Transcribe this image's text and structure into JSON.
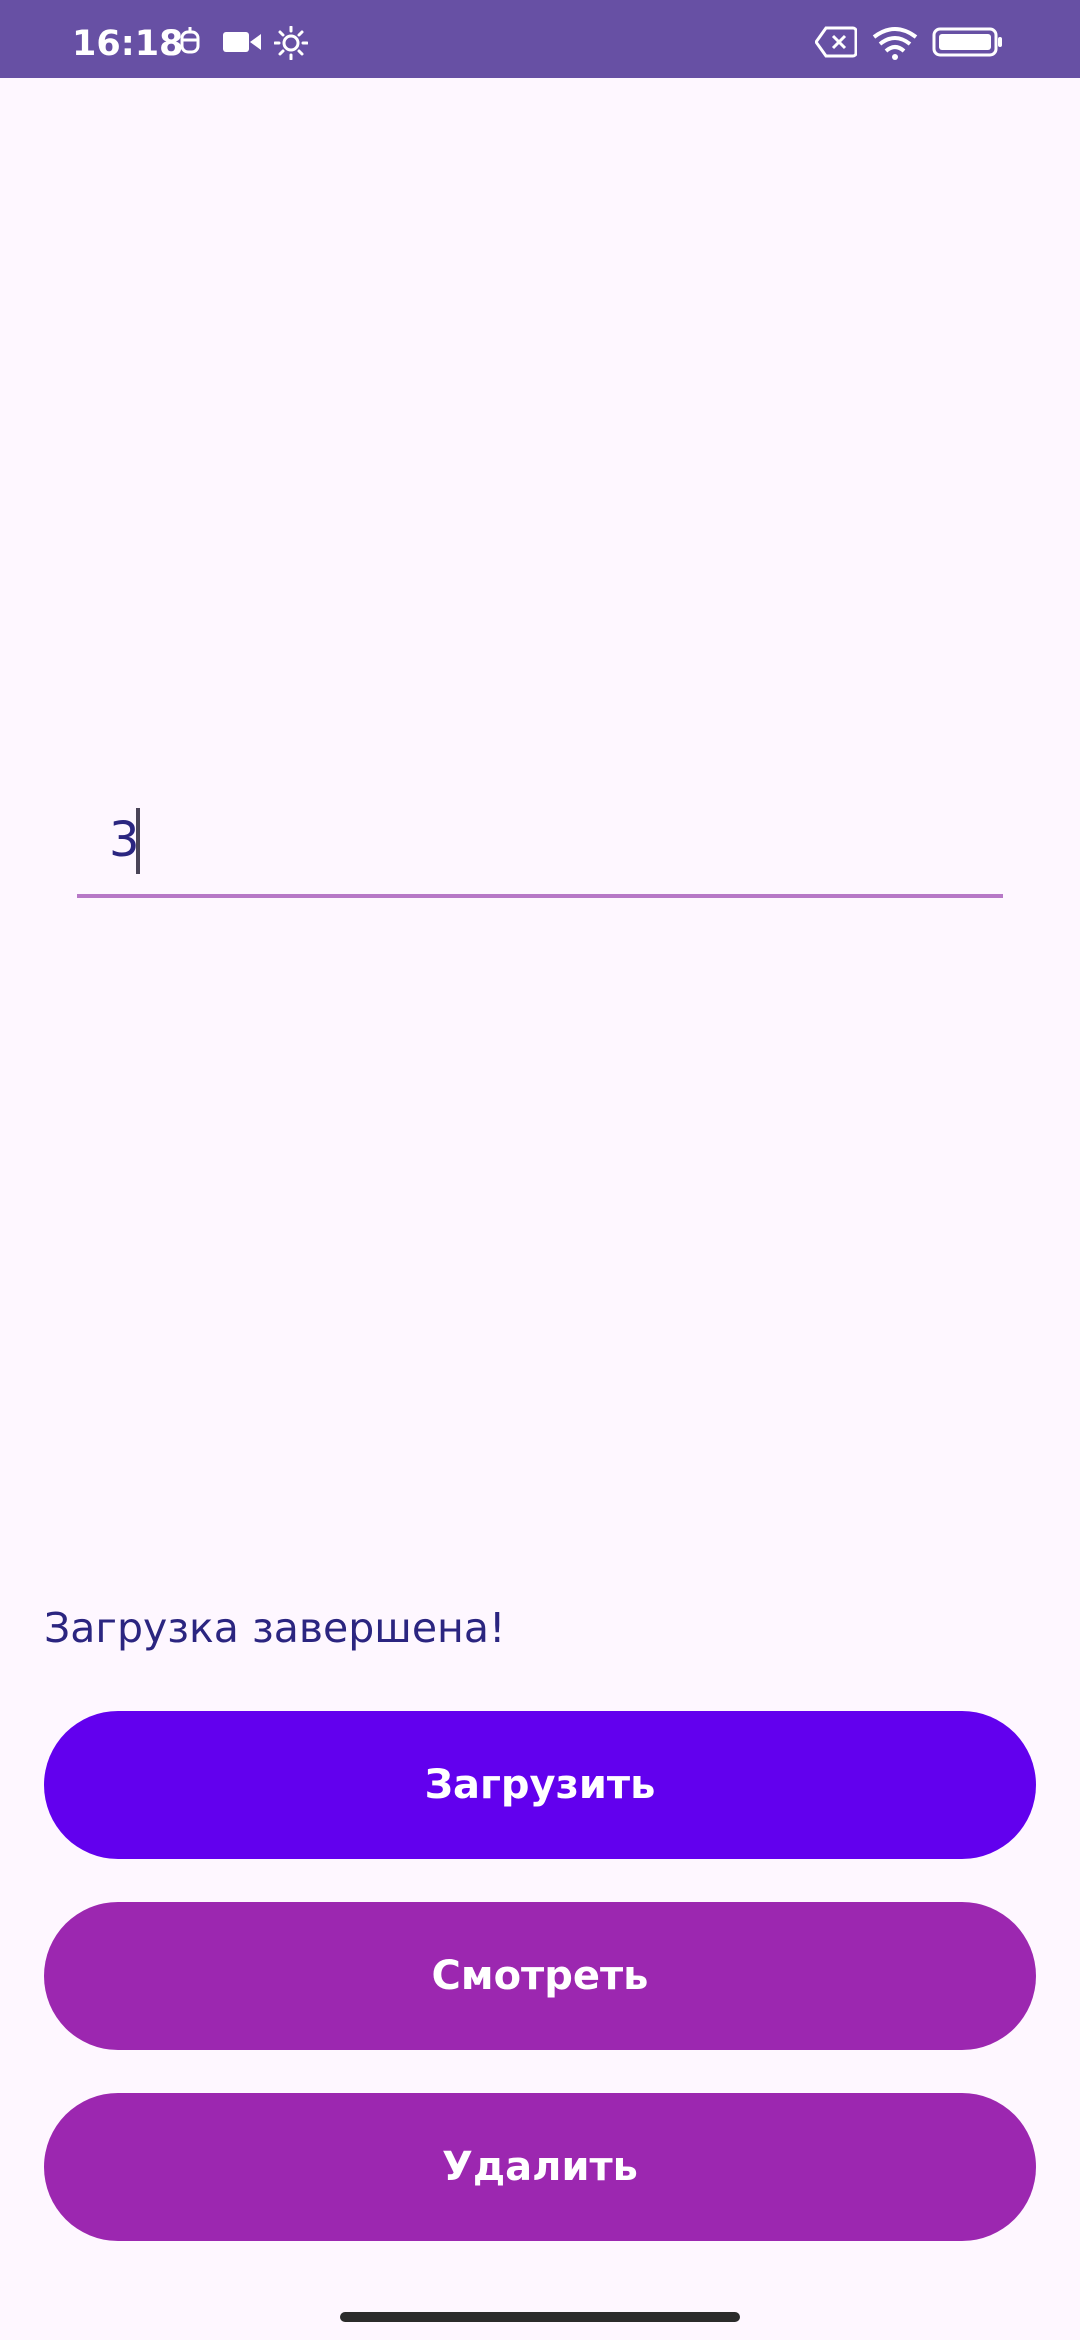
{
  "status_bar": {
    "time": "16:18",
    "background": "#6750A4",
    "icons_left": [
      "notification-icon",
      "video-icon",
      "brightness-icon"
    ],
    "icons_right": [
      "no-sim-icon",
      "wifi-icon",
      "battery-icon"
    ]
  },
  "text_field": {
    "value": "3",
    "underline_color": "#B778C7"
  },
  "status_message": "Загрузка завершена!",
  "buttons": {
    "load_label": "Загрузить",
    "view_label": "Смотреть",
    "delete_label": "Удалить",
    "load_color": "#6200EE",
    "secondary_color": "#9C27B0"
  }
}
